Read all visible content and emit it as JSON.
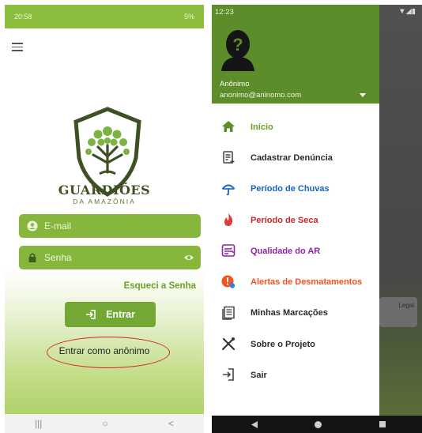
{
  "login": {
    "status_time": "20:58",
    "status_right": "5%",
    "brand_title": "GUARDIÕES",
    "brand_subtitle": "DA AMAZÔNIA",
    "email_placeholder": "E-mail",
    "password_placeholder": "Senha",
    "forgot_password": "Esqueci a Senha",
    "enter_button": "Entrar",
    "anonymous_link": "Entrar como anônimo",
    "nav": [
      "|||",
      "○",
      "<"
    ]
  },
  "drawer": {
    "status_time": "12:23",
    "user_name": "Anônimo",
    "user_email": "anonimo@aninomo.com",
    "background_card_label": "Legal",
    "menu": [
      {
        "label": "Início",
        "icon": "home-icon",
        "color": "#6a9b22"
      },
      {
        "label": "Cadastrar Denúncia",
        "icon": "note-add-icon",
        "color": "#2b2b2b"
      },
      {
        "label": "Período de Chuvas",
        "icon": "umbrella-icon",
        "color": "#1565c0"
      },
      {
        "label": "Período de Seca",
        "icon": "fire-icon",
        "color": "#c62828"
      },
      {
        "label": "Qualidade do AR",
        "icon": "air-quality-icon",
        "color": "#8e24aa"
      },
      {
        "label": "Alertas de Desmatamentos",
        "icon": "alert-icon",
        "color": "#f4511e"
      },
      {
        "label": "Minhas Marcações",
        "icon": "list-icon",
        "color": "#2b2b2b"
      },
      {
        "label": "Sobre o Projeto",
        "icon": "tools-icon",
        "color": "#2b2b2b"
      },
      {
        "label": "Sair",
        "icon": "logout-icon",
        "color": "#2b2b2b"
      }
    ]
  },
  "colors": {
    "brand_green": "#86b73c",
    "header_green": "#5d8d2b",
    "highlight_ring": "#d52525"
  }
}
